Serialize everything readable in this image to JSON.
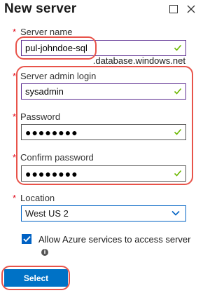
{
  "panel": {
    "title": "New server"
  },
  "form": {
    "server_name": {
      "label": "Server name",
      "value": "pul-johndoe-sql",
      "suffix": ".database.windows.net"
    },
    "admin_login": {
      "label": "Server admin login",
      "value": "sysadmin"
    },
    "password": {
      "label": "Password",
      "value": "●●●●●●●●"
    },
    "confirm_password": {
      "label": "Confirm password",
      "value": "●●●●●●●●"
    },
    "location": {
      "label": "Location",
      "value": "West US 2"
    },
    "allow_azure": {
      "label": "Allow Azure services to access server",
      "checked": true
    }
  },
  "footer": {
    "select_label": "Select"
  },
  "colors": {
    "accent": "#0072c6",
    "required": "#e00b1c",
    "highlight": "#e8534a",
    "valid": "#6bb700"
  },
  "icons": {
    "maximize": "square-icon",
    "close": "close-icon",
    "valid": "check-icon",
    "dropdown": "chevron-down-icon",
    "info": "info-icon"
  }
}
